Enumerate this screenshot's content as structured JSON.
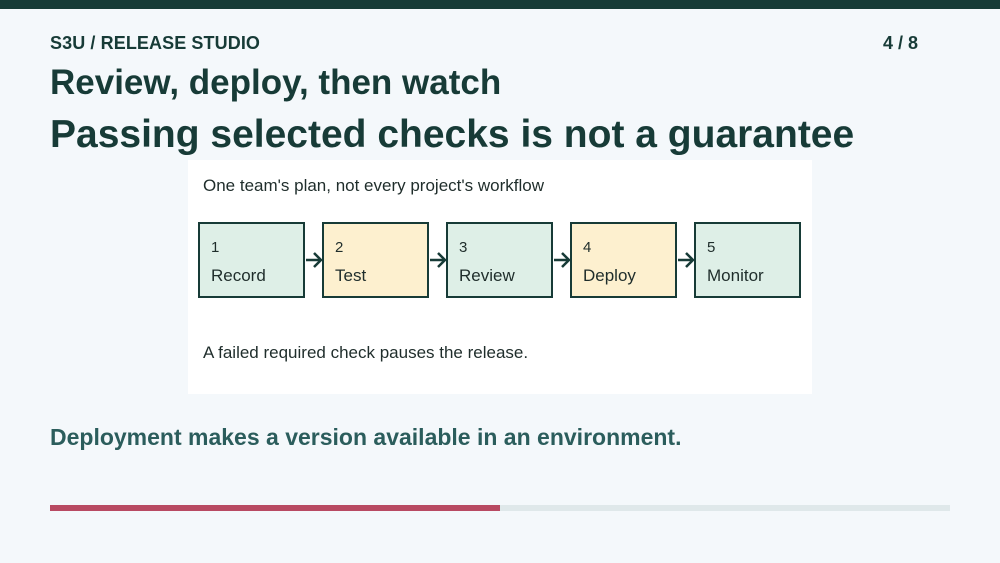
{
  "header": {
    "kicker": "S3U / RELEASE STUDIO",
    "page_counter": "4 / 8"
  },
  "slide": {
    "headline": "Review, deploy, then watch",
    "subheadline": "Passing selected checks is not a guarantee",
    "footer_text": "Deployment makes a version available in an environment."
  },
  "diagram": {
    "caption": "One team's plan, not every project's workflow",
    "note": "A failed required check pauses the release.",
    "steps": [
      {
        "num": "1",
        "label": "Record"
      },
      {
        "num": "2",
        "label": "Test"
      },
      {
        "num": "3",
        "label": "Review"
      },
      {
        "num": "4",
        "label": "Deploy"
      },
      {
        "num": "5",
        "label": "Monitor"
      }
    ]
  },
  "progress": {
    "fraction": 0.5
  },
  "colors": {
    "dark": "#173b37",
    "step_green": "#deefe7",
    "step_yellow": "#fdf0cf",
    "progress_fill": "#b84a62",
    "progress_track": "#dfe8ea"
  },
  "icons": {
    "connector": "arrow-right-icon"
  }
}
